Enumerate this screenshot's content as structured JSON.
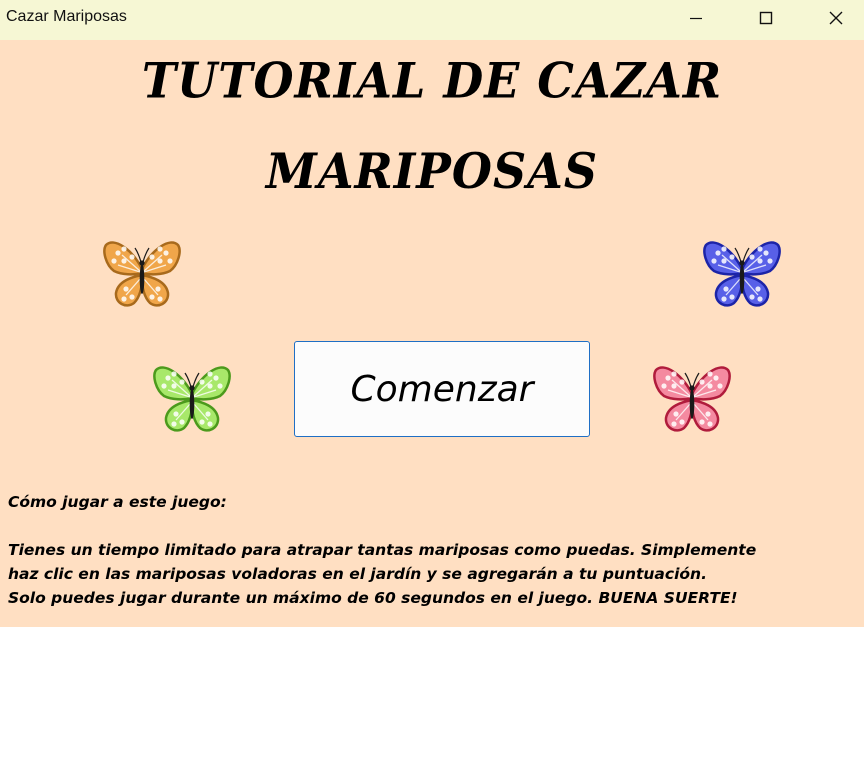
{
  "window": {
    "title": "Cazar Mariposas",
    "controls": [
      "minimize-icon",
      "maximize-icon",
      "close-icon"
    ]
  },
  "colors": {
    "titlebar": "#f6f7d4",
    "background": "#ffdfc2",
    "button_border": "#1f6fc5",
    "butterflies": [
      "#f0a64a",
      "#4a56e0",
      "#8ed94a",
      "#f26a8a"
    ]
  },
  "tutorial": {
    "title_line1": "TUTORIAL DE CAZAR",
    "title_line2": "MARIPOSAS",
    "start_button": "Comenzar",
    "howto_heading": "Cómo jugar a este juego:",
    "howto_lines": [
      "Tienes un tiempo limitado para atrapar tantas mariposas como puedas. Simplemente",
      "haz clic en las mariposas voladoras en el jardín y se agregarán a tu puntuación.",
      "Solo puedes jugar durante un máximo de 60 segundos en el juego. BUENA SUERTE!"
    ]
  },
  "butterflies": [
    {
      "name": "orange-butterfly-icon",
      "color": "#f0a64a",
      "edge": "#a86a1c"
    },
    {
      "name": "blue-butterfly-icon",
      "color": "#5860e8",
      "edge": "#1c24a8"
    },
    {
      "name": "green-butterfly-icon",
      "color": "#a8e86a",
      "edge": "#4c9a1c"
    },
    {
      "name": "pink-butterfly-icon",
      "color": "#f48aa0",
      "edge": "#b01c3c"
    }
  ]
}
